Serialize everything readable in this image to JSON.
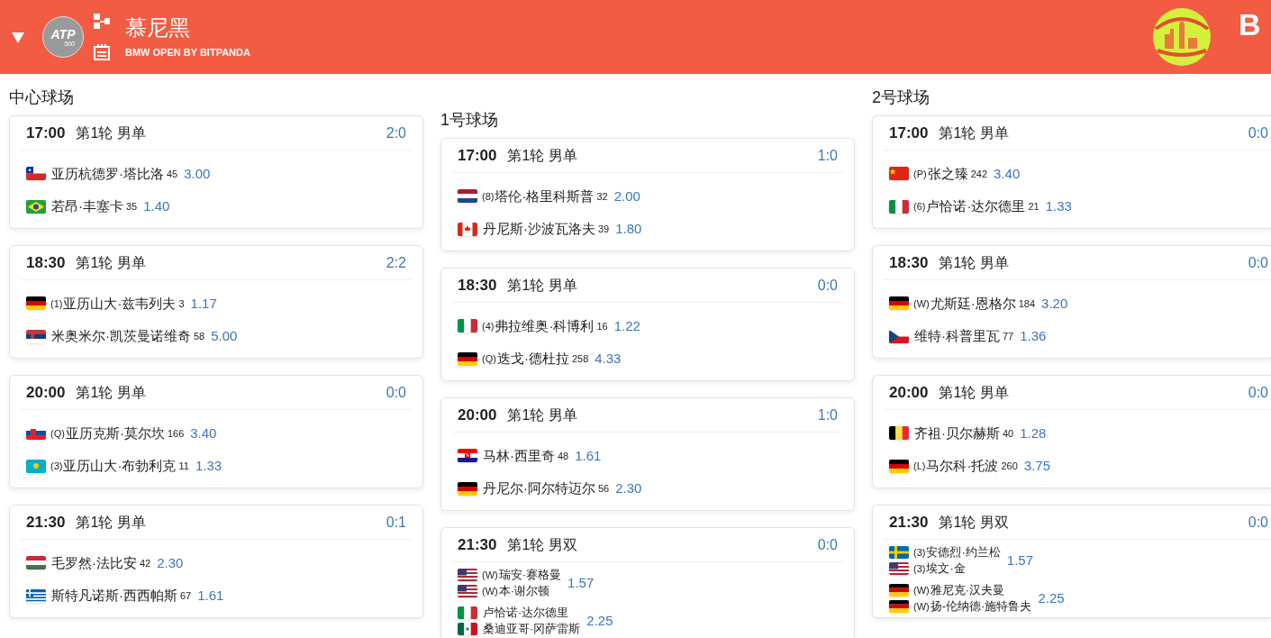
{
  "header": {
    "badge": {
      "text": "ATP",
      "sub": "500"
    },
    "title": "慕尼黑",
    "subtitle": "BMW OPEN BY BITPANDA",
    "right_text": "B"
  },
  "courts": [
    {
      "name": "中心球场",
      "matches": [
        {
          "time": "17:00",
          "round": "第1轮 男单",
          "score": "2:0",
          "kind": "singles",
          "teams": [
            {
              "players": [
                {
                  "kind": "cl",
                  "name": "亚历杭德罗·塔比洛",
                  "rank": "45"
                }
              ],
              "odds": "3.00"
            },
            {
              "players": [
                {
                  "kind": "br",
                  "name": "若昂·丰塞卡",
                  "rank": "35"
                }
              ],
              "odds": "1.40"
            }
          ]
        },
        {
          "time": "18:30",
          "round": "第1轮 男单",
          "score": "2:2",
          "kind": "singles",
          "teams": [
            {
              "players": [
                {
                  "kind": "de",
                  "seed": "(1)",
                  "name": "亚历山大·兹韦列夫",
                  "rank": "3"
                }
              ],
              "odds": "1.17"
            },
            {
              "players": [
                {
                  "kind": "rs",
                  "name": "米奥米尔·凯茨曼诺维奇",
                  "rank": "58"
                }
              ],
              "odds": "5.00"
            }
          ]
        },
        {
          "time": "20:00",
          "round": "第1轮 男单",
          "score": "0:0",
          "kind": "singles",
          "teams": [
            {
              "players": [
                {
                  "kind": "sk",
                  "seed": "(Q)",
                  "name": "亚历克斯·莫尔坎",
                  "rank": "166"
                }
              ],
              "odds": "3.40"
            },
            {
              "players": [
                {
                  "kind": "kz",
                  "seed": "(3)",
                  "name": "亚历山大·布勃利克",
                  "rank": "11"
                }
              ],
              "odds": "1.33"
            }
          ]
        },
        {
          "time": "21:30",
          "round": "第1轮 男单",
          "score": "0:1",
          "kind": "singles",
          "teams": [
            {
              "players": [
                {
                  "kind": "hu",
                  "name": "毛罗然·法比安",
                  "rank": "42"
                }
              ],
              "odds": "2.30"
            },
            {
              "players": [
                {
                  "kind": "gr",
                  "name": "斯特凡诺斯·西西帕斯",
                  "rank": "67"
                }
              ],
              "odds": "1.61"
            }
          ]
        }
      ]
    },
    {
      "name": "1号球场",
      "matches": [
        {
          "time": "17:00",
          "round": "第1轮 男单",
          "score": "1:0",
          "kind": "singles",
          "teams": [
            {
              "players": [
                {
                  "kind": "nl",
                  "seed": "(8)",
                  "name": "塔伦·格里科斯普",
                  "rank": "32"
                }
              ],
              "odds": "2.00"
            },
            {
              "players": [
                {
                  "kind": "ca",
                  "name": "丹尼斯·沙波瓦洛夫",
                  "rank": "39"
                }
              ],
              "odds": "1.80"
            }
          ]
        },
        {
          "time": "18:30",
          "round": "第1轮 男单",
          "score": "0:0",
          "kind": "singles",
          "teams": [
            {
              "players": [
                {
                  "kind": "it",
                  "seed": "(4)",
                  "name": "弗拉维奥·科博利",
                  "rank": "16"
                }
              ],
              "odds": "1.22"
            },
            {
              "players": [
                {
                  "kind": "de",
                  "seed": "(Q)",
                  "name": "迭戈·德杜拉",
                  "rank": "258"
                }
              ],
              "odds": "4.33"
            }
          ]
        },
        {
          "time": "20:00",
          "round": "第1轮 男单",
          "score": "1:0",
          "kind": "singles",
          "teams": [
            {
              "players": [
                {
                  "kind": "hr",
                  "name": "马林·西里奇",
                  "rank": "48"
                }
              ],
              "odds": "1.61"
            },
            {
              "players": [
                {
                  "kind": "de",
                  "name": "丹尼尔·阿尔特迈尔",
                  "rank": "56"
                }
              ],
              "odds": "2.30"
            }
          ]
        },
        {
          "time": "21:30",
          "round": "第1轮 男双",
          "score": "0:0",
          "kind": "doubles",
          "teams": [
            {
              "players": [
                {
                  "kind": "us",
                  "seed": "(W)",
                  "name": "瑞安·赛格曼"
                },
                {
                  "kind": "us",
                  "seed": "(W)",
                  "name": "本·谢尔顿"
                }
              ],
              "odds": "1.57"
            },
            {
              "players": [
                {
                  "kind": "it",
                  "name": "卢恰诺·达尔德里"
                },
                {
                  "kind": "mx",
                  "name": "桑迪亚哥·冈萨雷斯"
                }
              ],
              "odds": "2.25"
            }
          ]
        }
      ]
    },
    {
      "name": "2号球场",
      "matches": [
        {
          "time": "17:00",
          "round": "第1轮 男单",
          "score": "0:0",
          "kind": "singles",
          "teams": [
            {
              "players": [
                {
                  "kind": "cn",
                  "seed": "(P)",
                  "name": "张之臻",
                  "rank": "242"
                }
              ],
              "odds": "3.40"
            },
            {
              "players": [
                {
                  "kind": "it",
                  "seed": "(6)",
                  "name": "卢恰诺·达尔德里",
                  "rank": "21"
                }
              ],
              "odds": "1.33"
            }
          ]
        },
        {
          "time": "18:30",
          "round": "第1轮 男单",
          "score": "0:0",
          "kind": "singles",
          "teams": [
            {
              "players": [
                {
                  "kind": "de",
                  "seed": "(W)",
                  "name": "尤斯廷·恩格尔",
                  "rank": "184"
                }
              ],
              "odds": "3.20"
            },
            {
              "players": [
                {
                  "kind": "cz",
                  "name": "维特·科普里瓦",
                  "rank": "77"
                }
              ],
              "odds": "1.36"
            }
          ]
        },
        {
          "time": "20:00",
          "round": "第1轮 男单",
          "score": "0:0",
          "kind": "singles",
          "teams": [
            {
              "players": [
                {
                  "kind": "be",
                  "name": "齐祖·贝尔赫斯",
                  "rank": "40"
                }
              ],
              "odds": "1.28"
            },
            {
              "players": [
                {
                  "kind": "de",
                  "seed": "(L)",
                  "name": "马尔科·托波",
                  "rank": "260"
                }
              ],
              "odds": "3.75"
            }
          ]
        },
        {
          "time": "21:30",
          "round": "第1轮 男双",
          "score": "0:0",
          "kind": "doubles",
          "teams": [
            {
              "players": [
                {
                  "kind": "se",
                  "seed": "(3)",
                  "name": "安德烈·约兰松"
                },
                {
                  "kind": "us",
                  "seed": "(3)",
                  "name": "埃文·金"
                }
              ],
              "odds": "1.57"
            },
            {
              "players": [
                {
                  "kind": "de",
                  "seed": "(W)",
                  "name": "雅尼克·汉夫曼"
                },
                {
                  "kind": "de",
                  "seed": "(W)",
                  "name": "扬-伦纳德·施特鲁夫"
                }
              ],
              "odds": "2.25"
            }
          ]
        }
      ]
    }
  ]
}
